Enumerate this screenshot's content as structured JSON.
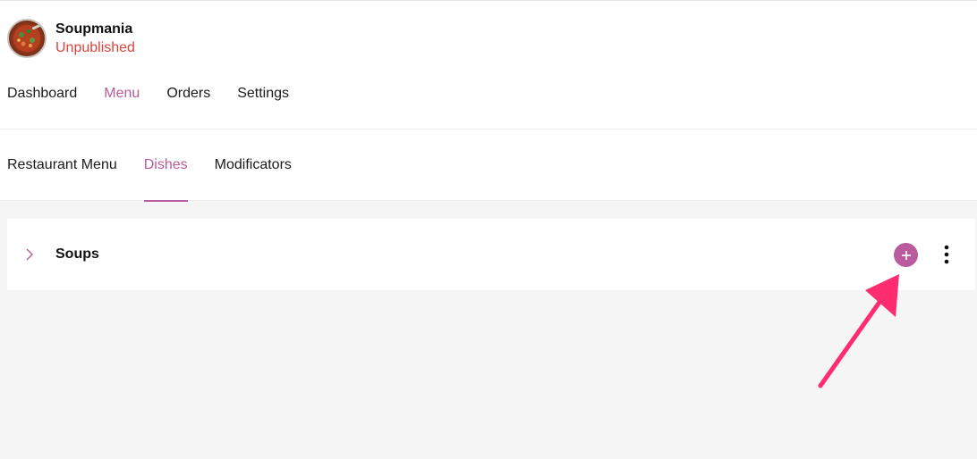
{
  "restaurant": {
    "name": "Soupmania",
    "status": "Unpublished",
    "avatar_icon": "soup-bowl"
  },
  "nav": {
    "tabs": [
      {
        "label": "Dashboard",
        "active": false
      },
      {
        "label": "Menu",
        "active": true
      },
      {
        "label": "Orders",
        "active": false
      },
      {
        "label": "Settings",
        "active": false
      }
    ]
  },
  "subnav": {
    "tabs": [
      {
        "label": "Restaurant Menu",
        "active": false
      },
      {
        "label": "Dishes",
        "active": true
      },
      {
        "label": "Modificators",
        "active": false
      }
    ]
  },
  "categories": [
    {
      "name": "Soups",
      "expand_icon": "chevron-right",
      "add_icon": "plus",
      "more_icon": "more-vertical"
    }
  ],
  "colors": {
    "accent": "#b95b9c",
    "status_unpublished": "#d9453f",
    "annotation_arrow": "#ff2d6f",
    "background": "#f5f5f5"
  }
}
